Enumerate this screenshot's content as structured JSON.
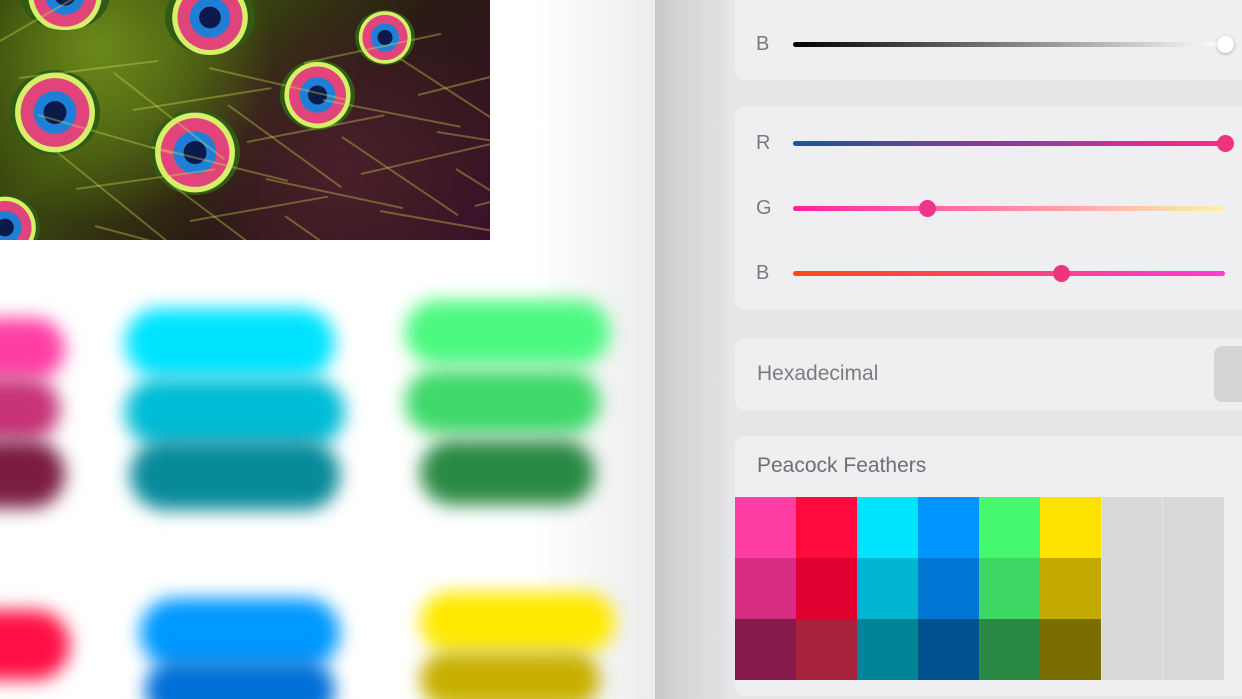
{
  "sliders_top": {
    "label": "B",
    "value": 1.0,
    "colors": [
      "#000000",
      "#ffffff"
    ]
  },
  "rgb_sliders": [
    {
      "label": "R",
      "value": 1.0,
      "colors": [
        "#1e4fa8",
        "#ff2a86"
      ],
      "thumb": "#f0347c"
    },
    {
      "label": "G",
      "value": 0.31,
      "colors": [
        "#ff1fa3",
        "#fff2a8"
      ],
      "thumb": "#f0348a"
    },
    {
      "label": "B",
      "value": 0.62,
      "colors": [
        "#ff4a14",
        "#ff3ad8"
      ],
      "thumb": "#f0347c"
    }
  ],
  "hex": {
    "label": "Hexadecimal"
  },
  "palette": {
    "title": "Peacock Feathers",
    "swatches": [
      [
        "#ff3ea5",
        "#ff0a3e",
        "#00e4ff",
        "#0095ff",
        "#45f86e",
        "#ffe300"
      ],
      [
        "#d62d83",
        "#e0002f",
        "#00b6d1",
        "#0076d4",
        "#3dd864",
        "#c3aa00"
      ],
      [
        "#861a4c",
        "#a8243c",
        "#008597",
        "#00528f",
        "#2a8a43",
        "#7b6e00"
      ]
    ]
  },
  "canvas": {
    "colors": {
      "pink": "#ff3ea5",
      "pink_mid": "#c73377",
      "pink_dark": "#7b1c42",
      "cyan": "#00e4ff",
      "cyan_mid": "#00bdd6",
      "cyan_dark": "#078a9a",
      "green": "#4cf980",
      "green_mid": "#3fd96a",
      "green_dark": "#2a8a44",
      "red": "#ff1045",
      "blue": "#0099ff",
      "blue_dark": "#0070d8",
      "yellow": "#ffe900",
      "yellow_dark": "#c7b000"
    }
  }
}
